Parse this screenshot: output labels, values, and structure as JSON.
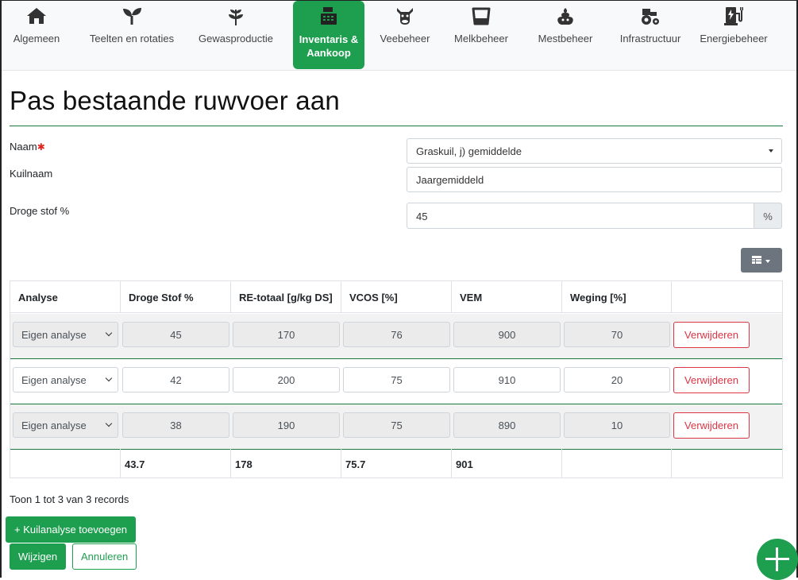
{
  "nav": [
    {
      "label": "Algemeen",
      "icon": "home-icon"
    },
    {
      "label": "Teelten en rotaties",
      "icon": "sprout-icon"
    },
    {
      "label": "Gewasproductie",
      "icon": "plant-icon"
    },
    {
      "label": "Inventaris & Aankoop",
      "icon": "cash-register-icon",
      "active": true
    },
    {
      "label": "Veebeheer",
      "icon": "cow-icon"
    },
    {
      "label": "Melkbeheer",
      "icon": "bucket-icon"
    },
    {
      "label": "Mestbeheer",
      "icon": "manure-icon"
    },
    {
      "label": "Infrastructuur",
      "icon": "tractor-icon"
    },
    {
      "label": "Energiebeheer",
      "icon": "charging-station-icon"
    }
  ],
  "page": {
    "title": "Pas bestaande ruwvoer aan"
  },
  "form": {
    "naam_label": "Naam",
    "required_mark": "✱",
    "naam_value": "Graskuil, j) gemiddelde",
    "kuilnaam_label": "Kuilnaam",
    "kuilnaam_value": "Jaargemiddeld",
    "drogestof_label": "Droge stof %",
    "drogestof_value": "45",
    "drogestof_unit": "%"
  },
  "table": {
    "headers": [
      "Analyse",
      "Droge Stof %",
      "RE-totaal [g/kg DS]",
      "VCOS [%]",
      "VEM",
      "Weging [%]",
      ""
    ],
    "rows": [
      {
        "analyse": "Eigen analyse",
        "ds": "45",
        "re": "170",
        "vcos": "76",
        "vem": "900",
        "weging": "70",
        "delete": "Verwijderen"
      },
      {
        "analyse": "Eigen analyse",
        "ds": "42",
        "re": "200",
        "vcos": "75",
        "vem": "910",
        "weging": "20",
        "delete": "Verwijderen"
      },
      {
        "analyse": "Eigen analyse",
        "ds": "38",
        "re": "190",
        "vcos": "75",
        "vem": "890",
        "weging": "10",
        "delete": "Verwijderen"
      }
    ],
    "totals": {
      "ds": "43.7",
      "re": "178",
      "vcos": "75.7",
      "vem": "901"
    }
  },
  "info": "Toon 1 tot 3 van 3 records",
  "buttons": {
    "add_analysis": "+ Kuilanalyse toevoegen",
    "save": "Wijzigen",
    "cancel": "Annuleren"
  },
  "colors": {
    "primary": "#1e9e4f",
    "danger": "#dc3545",
    "secondary": "#6c757d"
  }
}
